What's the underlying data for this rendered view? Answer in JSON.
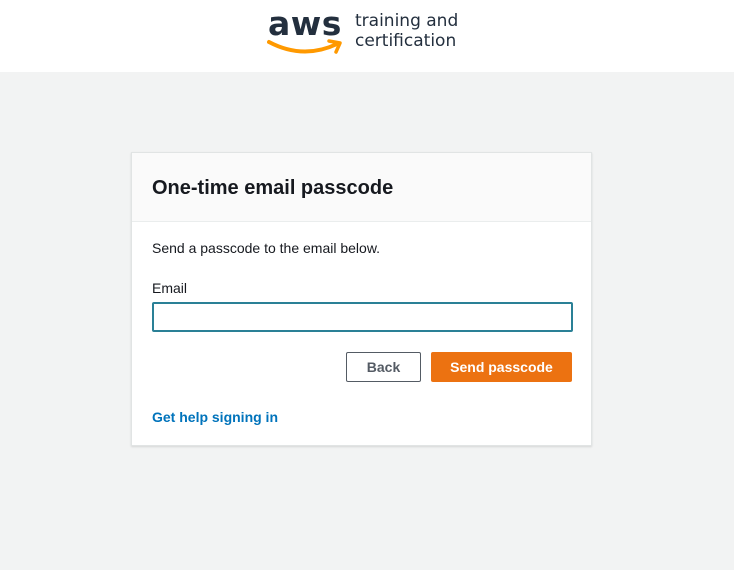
{
  "header": {
    "logo_word": "aws",
    "logo_line1": "training and",
    "logo_line2": "certification",
    "smile_color": "#ff9900"
  },
  "card": {
    "title": "One-time email passcode",
    "instruction": "Send a passcode to the email below.",
    "email_label": "Email",
    "email_value": "",
    "back_label": "Back",
    "send_label": "Send passcode",
    "help_link": "Get help signing in"
  },
  "colors": {
    "primary_button": "#ec7211",
    "link": "#0073bb",
    "input_focus_border": "#2a8096",
    "page_background": "#f2f3f3"
  }
}
